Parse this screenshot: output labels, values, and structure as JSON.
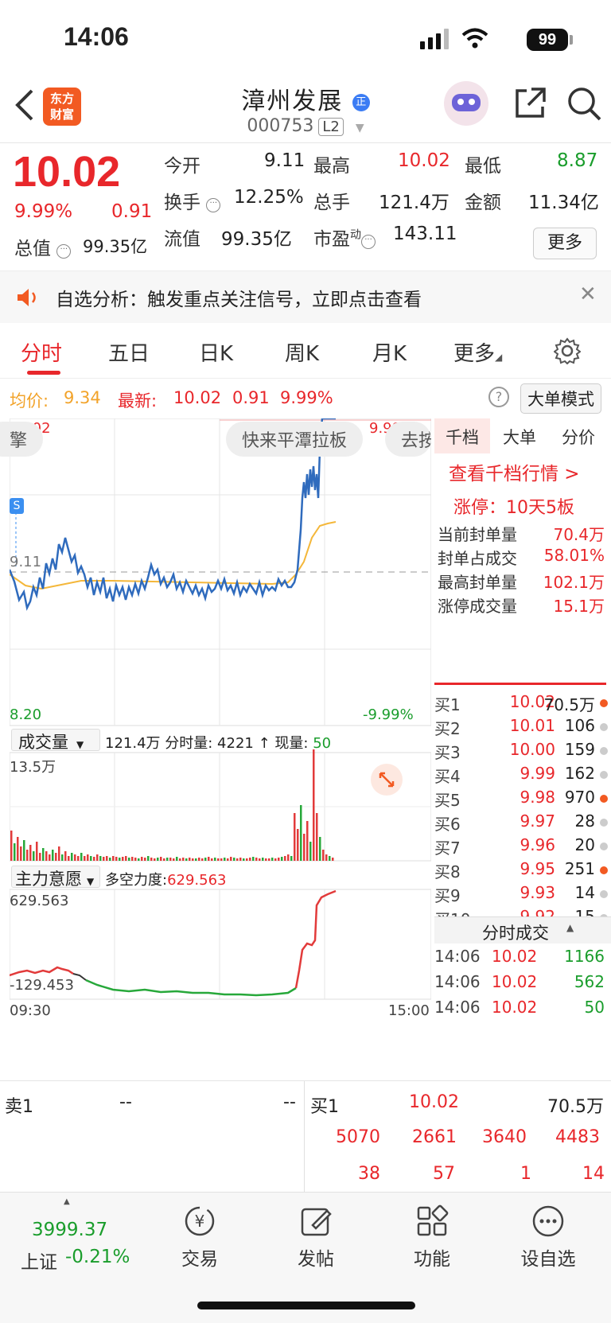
{
  "status_bar": {
    "time": "14:06",
    "battery": "99"
  },
  "header": {
    "back_label": "<",
    "logo_text": "东方财富",
    "stock_name": "漳州发展",
    "name_badge": "正",
    "stock_code": "000753",
    "level_badge": "L2"
  },
  "quote": {
    "price": "10.02",
    "change_pct": "9.99%",
    "change": "0.91",
    "total_value_label": "总值",
    "total_value": "99.35亿",
    "open_label": "今开",
    "open": "9.11",
    "high_label": "最高",
    "high": "10.02",
    "low_label": "最低",
    "low": "8.87",
    "turnover_label": "换手",
    "turnover": "12.25%",
    "volume_label": "总手",
    "volume": "121.4万",
    "amount_label": "金额",
    "amount": "11.34亿",
    "float_label": "流值",
    "float_value": "99.35亿",
    "pe_label": "市盈",
    "pe_sup": "动",
    "pe": "143.11",
    "more_button": "更多"
  },
  "notice": {
    "text": "自选分析：触发重点关注信号，立即点击查看"
  },
  "tabs": [
    "分时",
    "五日",
    "日K",
    "周K",
    "月K",
    "更多"
  ],
  "avg_row": {
    "avg_label": "均价:",
    "avg": "9.34",
    "latest_label": "最新:",
    "latest": "10.02",
    "change": "0.91",
    "change_pct": "9.99%",
    "mode_button": "大单模式"
  },
  "chart": {
    "top_price": "10.02",
    "top_pct": "9.99%",
    "bottom_price": "8.20",
    "bottom_pct": "-9.99%",
    "ref_price": "9.11",
    "pill_left": "擎",
    "pill_mid": "快来平潭拉板",
    "pill_right": "去按",
    "s_marker": "S",
    "vol_selector": "成交量",
    "vol_summary_total": "121.4万",
    "vol_summary_label": "分时量: 4221 ↑ 现量:",
    "vol_now": "50",
    "vol_max": "13.5万",
    "main_selector": "主力意愿",
    "main_label": "多空力度:",
    "main_value": "629.563",
    "main_top": "629.563",
    "main_bottom": "-129.453",
    "time_start": "09:30",
    "time_end": "15:00"
  },
  "right_panel": {
    "tabs": [
      "千档",
      "大单",
      "分价"
    ],
    "link": "查看千档行情 >",
    "limit_text": "涨停：10天5板",
    "stats": [
      {
        "label": "当前封单量",
        "value": "70.4万"
      },
      {
        "label": "封单占成交",
        "value": "58.01%"
      },
      {
        "label": "最高封单量",
        "value": "102.1万"
      },
      {
        "label": "涨停成交量",
        "value": "15.1万"
      }
    ],
    "bids": [
      {
        "label": "买1",
        "price": "10.02",
        "vol": "70.5万",
        "dot": "#f25a22"
      },
      {
        "label": "买2",
        "price": "10.01",
        "vol": "106",
        "dot": "#cccccc"
      },
      {
        "label": "买3",
        "price": "10.00",
        "vol": "159",
        "dot": "#cccccc"
      },
      {
        "label": "买4",
        "price": "9.99",
        "vol": "162",
        "dot": "#cccccc"
      },
      {
        "label": "买5",
        "price": "9.98",
        "vol": "970",
        "dot": "#f25a22"
      },
      {
        "label": "买6",
        "price": "9.97",
        "vol": "28",
        "dot": "#cccccc"
      },
      {
        "label": "买7",
        "price": "9.96",
        "vol": "20",
        "dot": "#cccccc"
      },
      {
        "label": "买8",
        "price": "9.95",
        "vol": "251",
        "dot": "#f25a22"
      },
      {
        "label": "买9",
        "price": "9.93",
        "vol": "14",
        "dot": "#cccccc"
      },
      {
        "label": "买10",
        "price": "9.92",
        "vol": "15",
        "dot": "#cccccc"
      }
    ],
    "ticks_title": "分时成交",
    "ticks": [
      {
        "time": "14:06",
        "price": "10.02",
        "vol": "1166"
      },
      {
        "time": "14:06",
        "price": "10.02",
        "vol": "562"
      },
      {
        "time": "14:06",
        "price": "10.02",
        "vol": "50"
      }
    ]
  },
  "book": {
    "sell_label": "卖1",
    "sell_price": "--",
    "sell_vol": "--",
    "buy_label": "买1",
    "buy_price": "10.02",
    "buy_vol": "70.5万",
    "row1": [
      "5070",
      "2661",
      "3640",
      "4483"
    ],
    "row2": [
      "38",
      "57",
      "1",
      "14"
    ]
  },
  "nav": {
    "index_value": "3999.37",
    "index_name": "上证",
    "index_change": "-0.21%",
    "items": [
      "交易",
      "发帖",
      "功能",
      "设自选"
    ]
  }
}
